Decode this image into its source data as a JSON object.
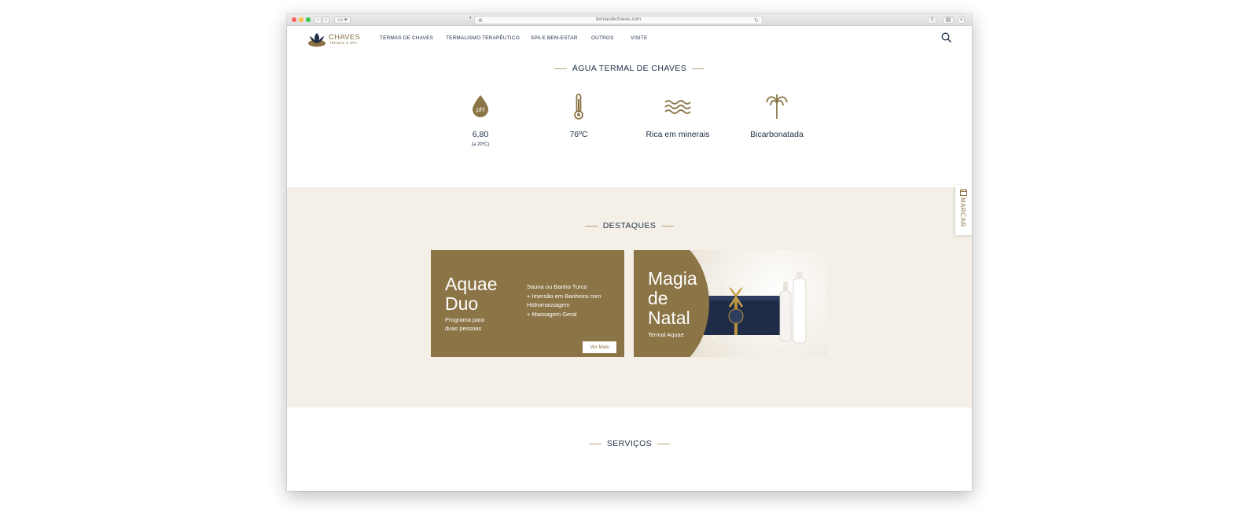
{
  "browser": {
    "url": "termasdechaves.com"
  },
  "logo": {
    "name": "CHAVES",
    "sub": "TERMAS & SPA"
  },
  "nav": {
    "items": [
      "TERMAS DE CHAVES",
      "TERMALISMO TERAPÊUTICO",
      "SPA E BEM-ESTAR",
      "OUTROS",
      "VISITE"
    ]
  },
  "water": {
    "title": "ÁGUA TERMAL DE CHAVES",
    "features": [
      {
        "icon": "ph-drop-icon",
        "label": "6,80",
        "note": "(a 20ºC)",
        "badge": "pH"
      },
      {
        "icon": "thermometer-icon",
        "label": "76ºC"
      },
      {
        "icon": "waves-icon",
        "label": "Rica em minerais"
      },
      {
        "icon": "fountain-icon",
        "label": "Bicarbonatada"
      }
    ]
  },
  "destaques": {
    "title": "DESTAQUES",
    "cards": [
      {
        "title": "Aquae\nDuo",
        "subtitle": "Programa para\nduas pessoas",
        "details": "Sauna ou Banho Turco\n+ Imersão em Banheira com\nHidromassagem\n+ Massagem Geral",
        "button": "Ver Mais"
      },
      {
        "title": "Magia\nde\nNatal",
        "subtitle": "Termal Aquae"
      }
    ]
  },
  "marcar": {
    "label": "MARCAR"
  },
  "servicos": {
    "title": "SERVIÇOS"
  },
  "colors": {
    "brand": "#8b7445",
    "navy": "#1d2d44",
    "beige": "#f4f0e7"
  }
}
